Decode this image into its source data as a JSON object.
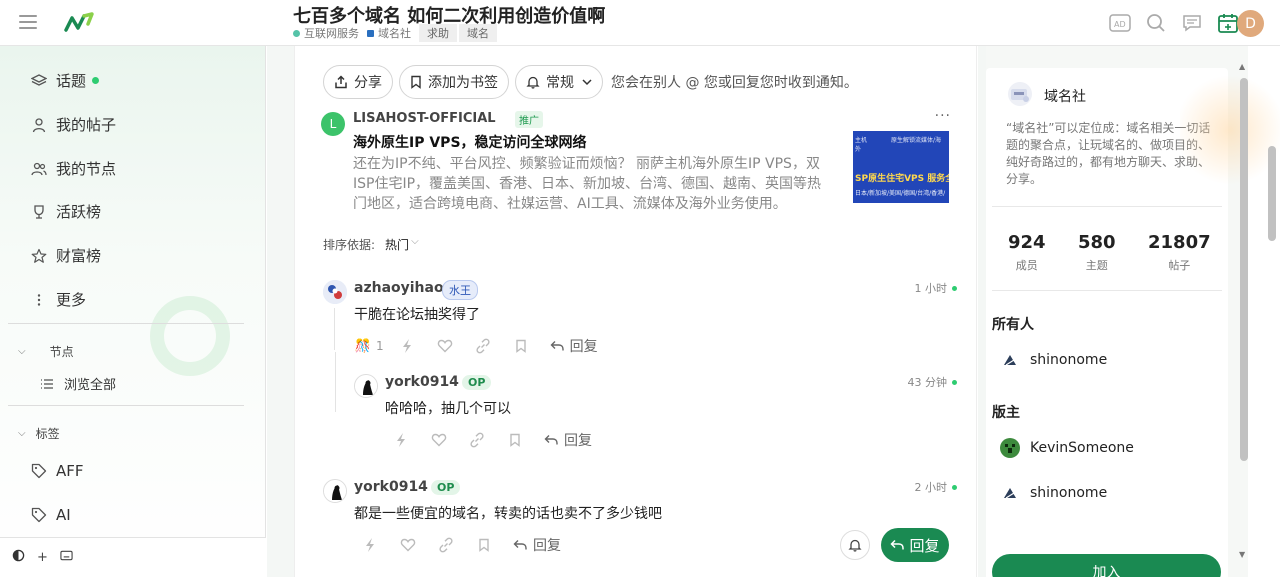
{
  "header": {
    "topic_title": "七百多个域名 如何二次利用创造价值啊",
    "crumbs": [
      {
        "label": "互联网服务",
        "color": "#55c3a8"
      },
      {
        "label": "域名社",
        "color": "#2a6fbf"
      }
    ],
    "tags": [
      "求助",
      "域名"
    ],
    "avatar_letter": "D",
    "brand_color": "#1a8a52"
  },
  "sidebar": {
    "items": [
      {
        "label": "话题"
      },
      {
        "label": "我的帖子"
      },
      {
        "label": "我的节点"
      },
      {
        "label": "活跃榜"
      },
      {
        "label": "财富榜"
      },
      {
        "label": "更多"
      }
    ],
    "nodes_header": "节点",
    "browse_all": "浏览全部",
    "tags_header": "标签",
    "tag_items": [
      "AFF",
      "AI"
    ]
  },
  "toolbar": {
    "share": "分享",
    "bookmark": "添加为书签",
    "notify": "常规",
    "notify_text": "您会在别人 @ 您或回复您时收到通知。"
  },
  "ad": {
    "avatar_letter": "L",
    "name": "LISAHOST-OFFICIAL",
    "badge": "推广",
    "more": "···",
    "title": "海外原生IP VPS，稳定访问全球网络",
    "body": "还在为IP不纯、平台风控、频繁验证而烦恼？ 丽萨主机海外原生IP VPS，双ISP住宅IP，覆盖美国、香港、日本、新加坡、台湾、德国、越南、英国等热门地区，适合跨境电商、社媒运营、AI工具、流媒体及海外业务使用。",
    "img_line1": "主机　　　　原生解锁流媒体/海外",
    "img_line2": "SP原生住宅VPS 服务全",
    "img_line3": "日本/新加坡/美国/德国/台湾/香港/"
  },
  "sort": {
    "label": "排序依据:",
    "value": "热门"
  },
  "posts": [
    {
      "user": "azhaoyihao",
      "badge": "水王",
      "time": "1 小时",
      "text": "干脆在论坛抽奖得了",
      "reaction_count": "1",
      "reply": "回复"
    },
    {
      "user": "york0914",
      "badge": "OP",
      "time": "43 分钟",
      "text": "哈哈哈，抽几个可以",
      "reply": "回复"
    },
    {
      "user": "york0914",
      "badge": "OP",
      "time": "2 小时",
      "text": "都是一些便宜的域名，转卖的话也卖不了多少钱吧",
      "reply": "回复"
    }
  ],
  "float_reply": "回复",
  "group": {
    "name": "域名社",
    "desc": "“域名社”可以定位成：域名相关一切话题的聚合点，让玩域名的、做项目的、纯好奇路过的，都有地方聊天、求助、分享。",
    "stats": [
      {
        "value": "924",
        "label": "成员"
      },
      {
        "value": "580",
        "label": "主题"
      },
      {
        "value": "21807",
        "label": "帖子"
      }
    ],
    "owner_header": "所有人",
    "owner": "shinonome",
    "mods_header": "版主",
    "mods": [
      "KevinSomeone",
      "shinonome"
    ],
    "join": "加入"
  }
}
